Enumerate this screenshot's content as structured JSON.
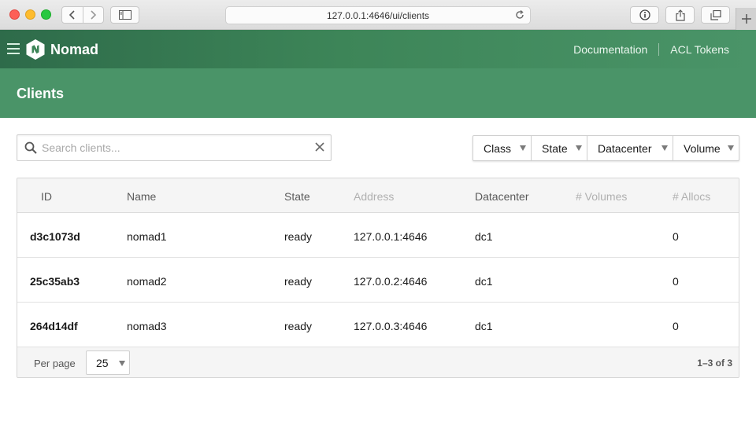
{
  "browser": {
    "url": "127.0.0.1:4646/ui/clients"
  },
  "topnav": {
    "brand": "Nomad",
    "links": [
      "Documentation",
      "ACL Tokens"
    ]
  },
  "page": {
    "title": "Clients"
  },
  "search": {
    "placeholder": "Search clients...",
    "value": ""
  },
  "facets": [
    "Class",
    "State",
    "Datacenter",
    "Volume"
  ],
  "table": {
    "columns": [
      "ID",
      "Name",
      "State",
      "Address",
      "Datacenter",
      "# Volumes",
      "# Allocs"
    ],
    "rows": [
      {
        "id": "d3c1073d",
        "name": "nomad1",
        "state": "ready",
        "address": "127.0.0.1:4646",
        "datacenter": "dc1",
        "volumes": "",
        "allocs": "0"
      },
      {
        "id": "25c35ab3",
        "name": "nomad2",
        "state": "ready",
        "address": "127.0.0.2:4646",
        "datacenter": "dc1",
        "volumes": "",
        "allocs": "0"
      },
      {
        "id": "264d14df",
        "name": "nomad3",
        "state": "ready",
        "address": "127.0.0.3:4646",
        "datacenter": "dc1",
        "volumes": "",
        "allocs": "0"
      }
    ]
  },
  "footer": {
    "per_page_label": "Per page",
    "per_page_value": "25",
    "pagination": "1–3 of 3"
  },
  "colors": {
    "brand_green": "#4a9468",
    "nav_dark_green": "#2e6b4a"
  }
}
